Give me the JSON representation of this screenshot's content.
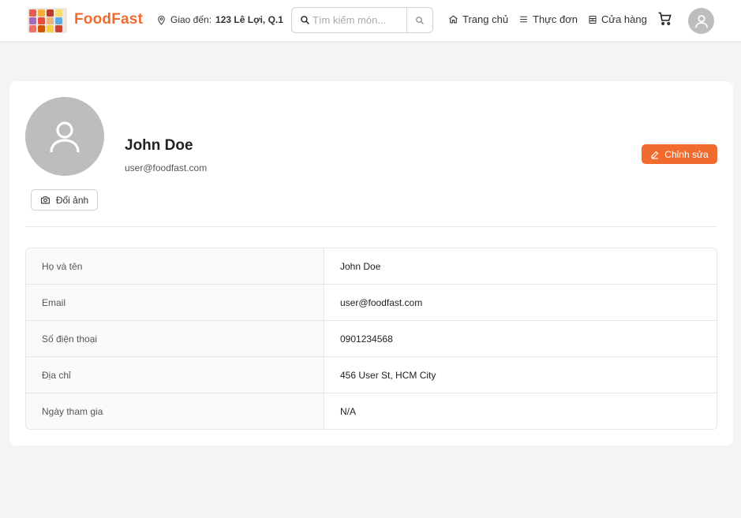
{
  "header": {
    "brand": "FoodFast",
    "delivery_prefix": "Giao đến:",
    "delivery_address": "123 Lê Lợi, Q.1",
    "search_placeholder": "Tìm kiếm món...",
    "nav": [
      {
        "label": "Trang chủ",
        "icon": "home-icon"
      },
      {
        "label": "Thực đơn",
        "icon": "menu-list-icon"
      },
      {
        "label": "Cửa hàng",
        "icon": "store-icon"
      }
    ],
    "cart_icon": "cart-icon",
    "avatar_icon": "user-avatar-icon"
  },
  "profile": {
    "name": "John Doe",
    "email": "user@foodfast.com",
    "change_photo_label": "Đổi ảnh",
    "edit_label": "Chỉnh sửa"
  },
  "details": [
    {
      "label": "Họ và tên",
      "value": "John Doe"
    },
    {
      "label": "Email",
      "value": "user@foodfast.com"
    },
    {
      "label": "Số điện thoại",
      "value": "0901234568"
    },
    {
      "label": "Địa chỉ",
      "value": "456 User St, HCM City"
    },
    {
      "label": "Ngày tham gia",
      "value": "N/A"
    }
  ],
  "colors": {
    "accent": "#f26b2e",
    "avatar_bg": "#bdbdbd",
    "page_bg": "#f4f4f4"
  }
}
